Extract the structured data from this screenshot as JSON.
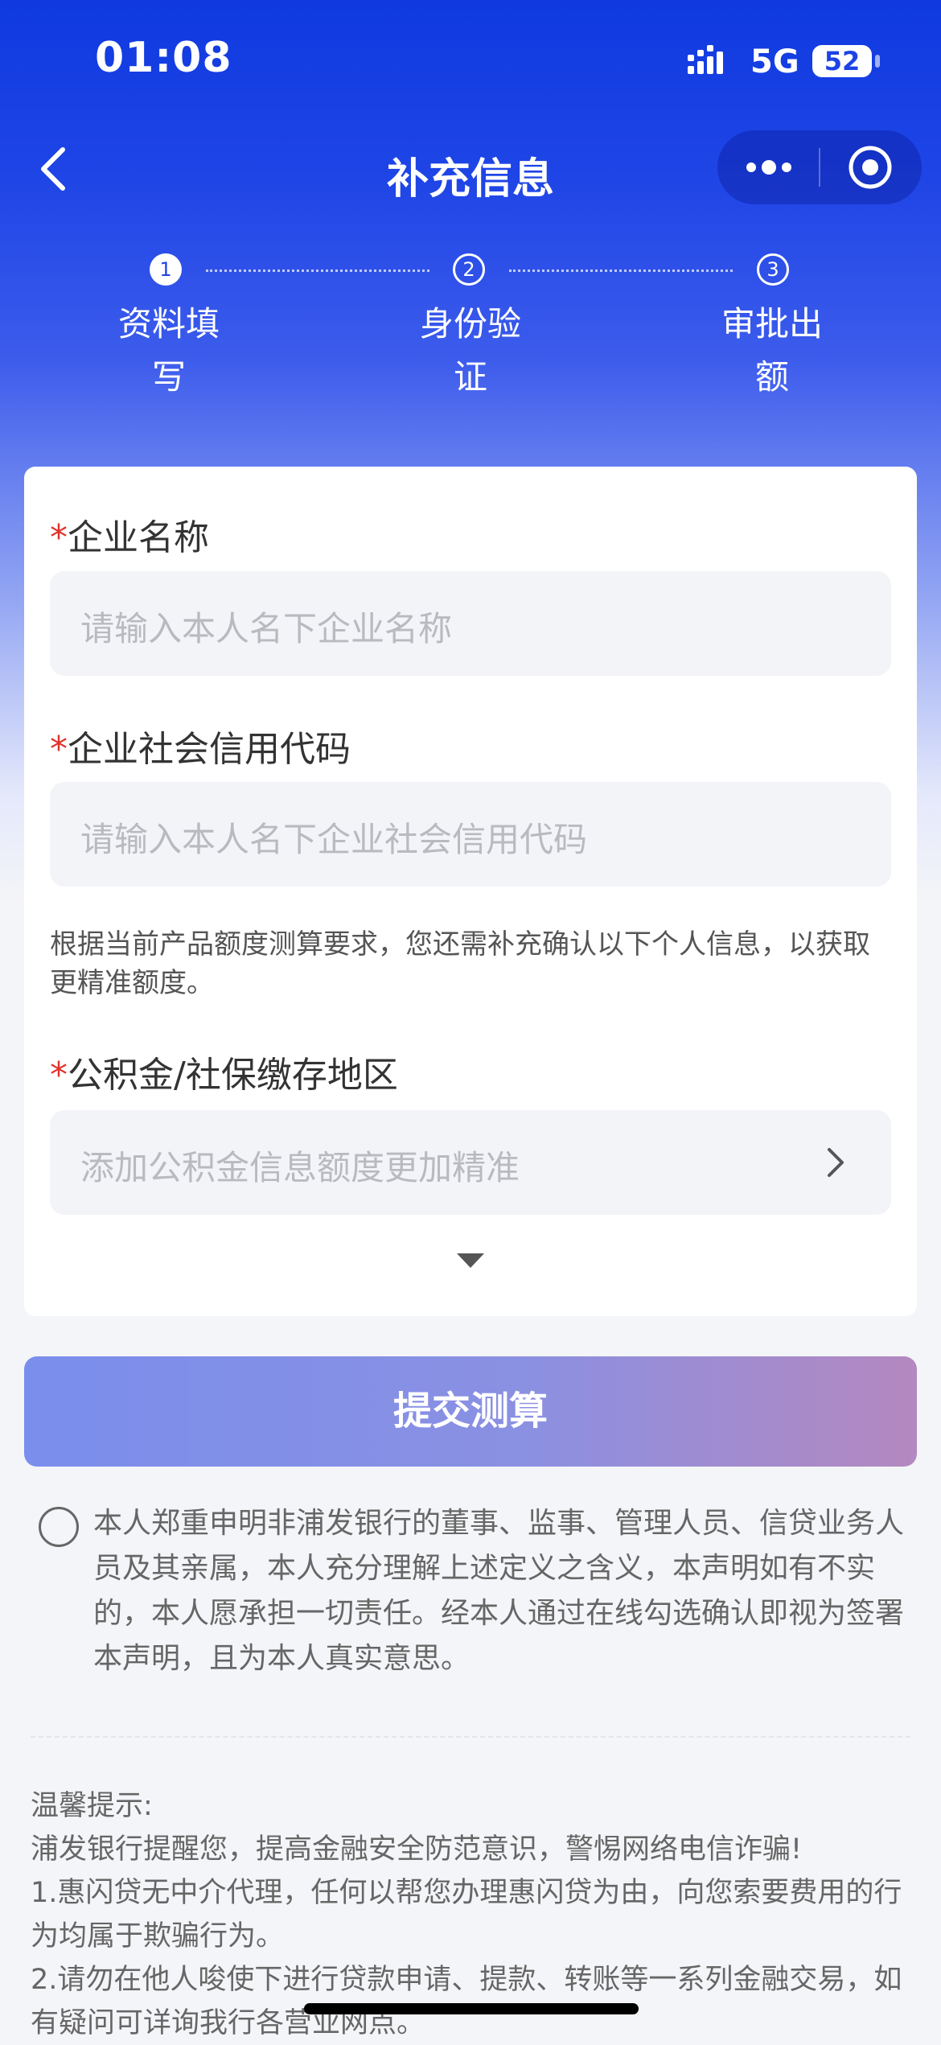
{
  "status_bar": {
    "time": "01:08",
    "network": "5G",
    "battery": "52"
  },
  "nav": {
    "title": "补充信息"
  },
  "steps": [
    {
      "num": "1",
      "line1": "资料填",
      "line2": "写"
    },
    {
      "num": "2",
      "line1": "身份验",
      "line2": "证"
    },
    {
      "num": "3",
      "line1": "审批出",
      "line2": "额"
    }
  ],
  "form": {
    "required_mark": "*",
    "company_name": {
      "label": "企业名称",
      "placeholder": "请输入本人名下企业名称"
    },
    "credit_code": {
      "label": "企业社会信用代码",
      "placeholder": "请输入本人名下企业社会信用代码"
    },
    "note": "根据当前产品额度测算要求，您还需补充确认以下个人信息，以获取更精准额度。",
    "region": {
      "label": "公积金/社保缴存地区",
      "placeholder": "添加公积金信息额度更加精准"
    }
  },
  "submit_label": "提交测算",
  "agreement_text": "本人郑重申明非浦发银行的董事、监事、管理人员、信贷业务人员及其亲属，本人充分理解上述定义之含义，本声明如有不实的，本人愿承担一切责任。经本人通过在线勾选确认即视为签署本声明，且为本人真实意思。",
  "tips": {
    "title": "温馨提示:",
    "line1": "浦发银行提醒您，提高金融安全防范意识，警惕网络电信诈骗!",
    "line2": "1.惠闪贷无中介代理，任何以帮您办理惠闪贷为由，向您索要费用的行为均属于欺骗行为。",
    "line3": "2.请勿在他人唆使下进行贷款申请、提款、转账等一系列金融交易，如有疑问可详询我行各营业网点。"
  }
}
